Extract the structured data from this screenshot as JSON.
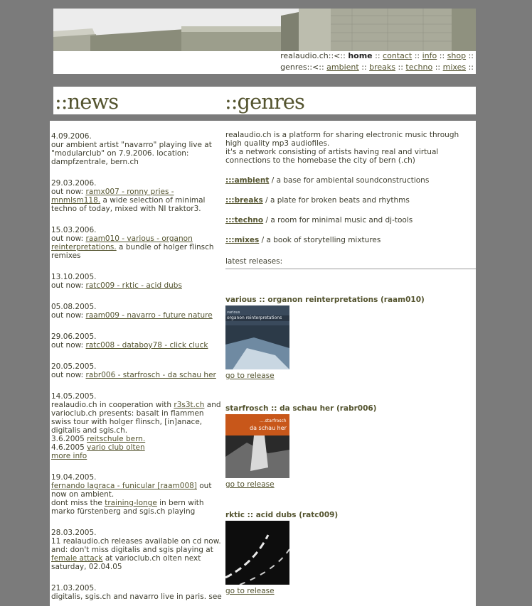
{
  "header": {
    "nav1": {
      "prefix": "realaudio.ch::<::",
      "home": "home",
      "contact": "contact",
      "info": "info",
      "shop": "shop"
    },
    "nav2": {
      "prefix": "genres::<::",
      "ambient": "ambient",
      "breaks": "breaks",
      "techno": "techno",
      "mixes": "mixes"
    }
  },
  "titles": {
    "news": "::news",
    "genres": "::genres"
  },
  "news": [
    {
      "date": "4.09.2006.",
      "text": "our ambient artist \"navarro\" playing live at \"modularclub\" on 7.9.2006. location: dampfzentrale, bern.ch"
    },
    {
      "date": "29.03.2006.",
      "pre": "out now:",
      "link": "ramx007 - ronny pries - mnmlsm118.",
      "post": "a wide selection of minimal techno of today, mixed with NI traktor3."
    },
    {
      "date": "15.03.2006.",
      "pre": "out now:",
      "link": "raam010 - various - organon reinterpretations.",
      "post": "a bundle of holger flinsch remixes"
    },
    {
      "date": "13.10.2005.",
      "pre": "out now:",
      "link": "ratc009 - rktic - acid dubs"
    },
    {
      "date": "05.08.2005.",
      "pre": "out now:",
      "link": "raam009 - navarro - future nature"
    },
    {
      "date": "29.06.2005.",
      "pre": "out now:",
      "link": "ratc008 - databoy78 - click cluck"
    },
    {
      "date": "20.05.2005.",
      "pre": "out now:",
      "link": "rabr006 - starfrosch - da schau her"
    },
    {
      "date": "14.05.2005.",
      "a": "realaudio.ch in cooperation with",
      "b": "r3s3t.ch",
      "c": "and varioclub.ch presents: basalt in flammen swiss tour with holger flinsch, [in]anace, digitalis and sgis.ch.",
      "d": "3.6.2005",
      "e": "reitschule bern.",
      "f": "4.6.2005",
      "g": "vario club olten",
      "h": "more info"
    },
    {
      "date": "19.04.2005.",
      "a": "fernando lagraca - funicular [raam008]",
      "b": "out now on ambient.",
      "c": "dont miss the",
      "d": "training-longe",
      "e": "in bern with marko fürstenberg and sgis.ch playing"
    },
    {
      "date": "28.03.2005.",
      "a": "11 realaudio.ch releases available on cd now. and: don't miss digitalis and sgis playing at",
      "b": "female attack",
      "c": "at varioclub.ch olten next saturday, 02.04.05"
    },
    {
      "date": "21.03.2005.",
      "text": "digitalis, sgis.ch and navarro live in paris. see"
    }
  ],
  "genres": {
    "intro": "realaudio.ch is a platform for sharing electronic music through high quality mp3 audiofiles.",
    "intro2": "it's a network consisting of artists having real and virtual connections to the homebase the city of bern (.ch)",
    "items": [
      {
        "label": ":::ambient",
        "desc": "/ a base for ambiental soundconstructions"
      },
      {
        "label": ":::breaks",
        "desc": "/ a plate for broken beats and rhythms"
      },
      {
        "label": ":::techno",
        "desc": "/ a room for minimal music and dj-tools"
      },
      {
        "label": ":::mixes",
        "desc": "/ a book of storytelling mixtures"
      }
    ],
    "latest": "latest releases:",
    "releases": [
      {
        "title": "various :: organon reinterpretations (raam010)",
        "cover_a": "various",
        "cover_b": "organon reinterpretations",
        "link": "go to release"
      },
      {
        "title": "starfrosch :: da schau her (rabr006)",
        "cover_a": "....starfrosch",
        "cover_b": "da schau her",
        "link": "go to release"
      },
      {
        "title": "rktic :: acid dubs (ratc009)",
        "cover_a": "",
        "cover_b": "",
        "link": "go to release"
      }
    ]
  }
}
